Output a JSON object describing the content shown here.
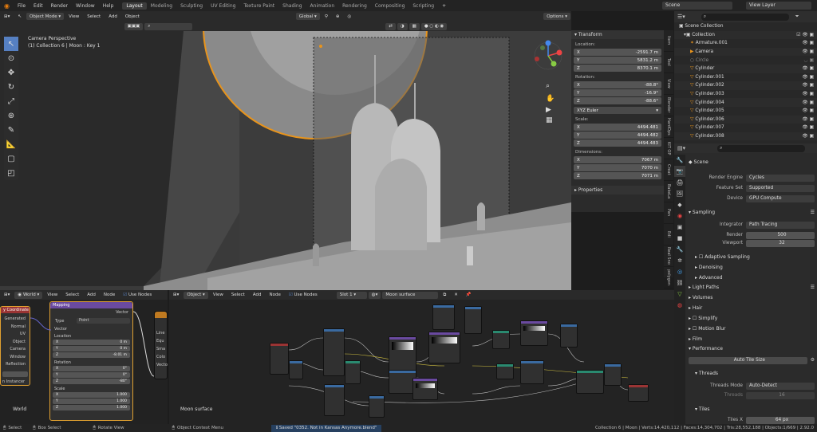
{
  "topmenu": {
    "items": [
      "File",
      "Edit",
      "Render",
      "Window",
      "Help"
    ],
    "workspaces": [
      "Layout",
      "Modeling",
      "Sculpting",
      "UV Editing",
      "Texture Paint",
      "Shading",
      "Animation",
      "Rendering",
      "Compositing",
      "Scripting"
    ],
    "active_workspace": "Layout",
    "scene": "Scene",
    "view_layer": "View Layer"
  },
  "viewport": {
    "mode": "Object Mode",
    "menus": [
      "View",
      "Select",
      "Add",
      "Object"
    ],
    "orientation": "Global",
    "options": "Options",
    "info_line1": "Camera Perspective",
    "info_line2": "(1) Collection 6 | Moon : Key 1"
  },
  "npanel": {
    "transform_title": "Transform",
    "location_label": "Location:",
    "location": [
      {
        "axis": "X",
        "value": "-2591.7 m"
      },
      {
        "axis": "Y",
        "value": "5831.2 m"
      },
      {
        "axis": "Z",
        "value": "8370.1 m"
      }
    ],
    "rotation_label": "Rotation:",
    "rotation": [
      {
        "axis": "X",
        "value": "-88.8°"
      },
      {
        "axis": "Y",
        "value": "-16.9°"
      },
      {
        "axis": "Z",
        "value": "-88.6°"
      }
    ],
    "rotation_mode": "XYZ Euler",
    "scale_label": "Scale:",
    "scale": [
      {
        "axis": "X",
        "value": "4494.481"
      },
      {
        "axis": "Y",
        "value": "4494.482"
      },
      {
        "axis": "Z",
        "value": "4494.483"
      }
    ],
    "dimensions_label": "Dimensions:",
    "dimensions": [
      {
        "axis": "X",
        "value": "7067 m"
      },
      {
        "axis": "Y",
        "value": "7070 m"
      },
      {
        "axis": "Z",
        "value": "7071 m"
      }
    ],
    "properties_title": "Properties"
  },
  "sidetabs": [
    "Item",
    "Tool",
    "View",
    "Blender",
    "HardOps",
    "KIT OP",
    "Creat",
    "BakeLa",
    "Pan",
    "Edi",
    "Real Sno",
    "polygon"
  ],
  "outliner": {
    "root": "Scene Collection",
    "items": [
      "Collection",
      "Armature.001",
      "Camera",
      "Circle",
      "Cylinder",
      "Cylinder.001",
      "Cylinder.002",
      "Cylinder.003",
      "Cylinder.004",
      "Cylinder.005",
      "Cylinder.006",
      "Cylinder.007",
      "Cylinder.008"
    ]
  },
  "properties": {
    "context": "Scene",
    "render_engine_label": "Render Engine",
    "render_engine": "Cycles",
    "feature_set_label": "Feature Set",
    "feature_set": "Supported",
    "device_label": "Device",
    "device": "GPU Compute",
    "sampling": "Sampling",
    "integrator_label": "Integrator",
    "integrator": "Path Tracing",
    "render_label": "Render",
    "render_samples": "500",
    "viewport_label": "Viewport",
    "viewport_samples": "32",
    "adaptive": "Adaptive Sampling",
    "denoising": "Denoising",
    "advanced": "Advanced",
    "light_paths": "Light Paths",
    "volumes": "Volumes",
    "hair": "Hair",
    "simplify": "Simplify",
    "motion_blur": "Motion Blur",
    "film": "Film",
    "performance": "Performance",
    "auto_tile": "Auto Tile Size",
    "threads": "Threads",
    "threads_mode_label": "Threads Mode",
    "threads_mode": "Auto-Detect",
    "threads_count_label": "Threads",
    "threads_count": "16",
    "tiles": "Tiles",
    "tiles_x_label": "Tiles X",
    "tiles_x": "64 px"
  },
  "node_left": {
    "context": "World",
    "menus": [
      "View",
      "Select",
      "Add",
      "Node"
    ],
    "use_nodes": "Use Nodes",
    "coord_title": "y Coordinate",
    "coord_outputs": [
      "Generated",
      "Normal",
      "UV",
      "Object",
      "Camera",
      "Window",
      "Reflection"
    ],
    "instancer": "n Instancer",
    "mapping_title": "Mapping",
    "mapping_vector": "Vector",
    "type_label": "Type",
    "type_value": "Point",
    "vector_in": "Vector",
    "location_label": "Location",
    "location": [
      {
        "axis": "X",
        "value": "0 m"
      },
      {
        "axis": "Y",
        "value": "0 m"
      },
      {
        "axis": "Z",
        "value": "-8.01 m"
      }
    ],
    "rotation_label": "Rotation",
    "rotation": [
      {
        "axis": "X",
        "value": "0°"
      },
      {
        "axis": "Y",
        "value": "0°"
      },
      {
        "axis": "Z",
        "value": "-80°"
      }
    ],
    "scale_label": "Scale",
    "scale": [
      {
        "axis": "X",
        "value": "1.000"
      },
      {
        "axis": "Y",
        "value": "1.000"
      },
      {
        "axis": "Z",
        "value": "1.000"
      }
    ],
    "third_items": [
      "Line",
      "Equ",
      "Sma",
      "Colo",
      "Vecto"
    ],
    "footer": "World"
  },
  "node_right": {
    "context": "Object",
    "menus": [
      "View",
      "Select",
      "Add",
      "Node"
    ],
    "use_nodes": "Use Nodes",
    "slot": "Slot 1",
    "material": "Moon surface",
    "footer": "Moon surface"
  },
  "statusbar": {
    "select": "Select",
    "box_select": "Box Select",
    "rotate_view": "Rotate View",
    "context_menu": "Object Context Menu",
    "saved": "Saved \"0352. Not in Kansas Anymore.blend\"",
    "stats": "Collection 6 | Moon | Verts:14,420,112 | Faces:14,304,702 | Tris:28,552,188 | Objects:1/669 | 2.92.0"
  }
}
